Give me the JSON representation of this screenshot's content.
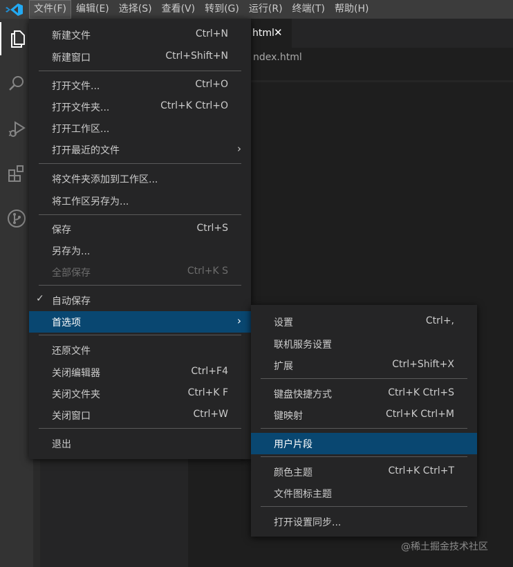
{
  "menubar": {
    "items": [
      {
        "label": "文件(F)"
      },
      {
        "label": "编辑(E)"
      },
      {
        "label": "选择(S)"
      },
      {
        "label": "查看(V)"
      },
      {
        "label": "转到(G)"
      },
      {
        "label": "运行(R)"
      },
      {
        "label": "终端(T)"
      },
      {
        "label": "帮助(H)"
      }
    ]
  },
  "editor": {
    "tab_label": "html",
    "tab_close": "✕",
    "breadcrumb": "ndex.html"
  },
  "file_menu": {
    "items": [
      {
        "label": "新建文件",
        "shortcut": "Ctrl+N"
      },
      {
        "label": "新建窗口",
        "shortcut": "Ctrl+Shift+N"
      },
      {
        "label": "打开文件...",
        "shortcut": "Ctrl+O"
      },
      {
        "label": "打开文件夹...",
        "shortcut": "Ctrl+K Ctrl+O"
      },
      {
        "label": "打开工作区..."
      },
      {
        "label": "打开最近的文件",
        "submenu_arrow": "›"
      },
      {
        "label": "将文件夹添加到工作区..."
      },
      {
        "label": "将工作区另存为..."
      },
      {
        "label": "保存",
        "shortcut": "Ctrl+S"
      },
      {
        "label": "另存为..."
      },
      {
        "label": "全部保存",
        "shortcut": "Ctrl+K S"
      },
      {
        "label": "自动保存",
        "check": "✓"
      },
      {
        "label": "首选项",
        "submenu_arrow": "›"
      },
      {
        "label": "还原文件"
      },
      {
        "label": "关闭编辑器",
        "shortcut": "Ctrl+F4"
      },
      {
        "label": "关闭文件夹",
        "shortcut": "Ctrl+K F"
      },
      {
        "label": "关闭窗口",
        "shortcut": "Ctrl+W"
      },
      {
        "label": "退出"
      }
    ]
  },
  "pref_menu": {
    "items": [
      {
        "label": "设置",
        "shortcut": "Ctrl+,"
      },
      {
        "label": "联机服务设置"
      },
      {
        "label": "扩展",
        "shortcut": "Ctrl+Shift+X"
      },
      {
        "label": "键盘快捷方式",
        "shortcut": "Ctrl+K Ctrl+S"
      },
      {
        "label": "键映射",
        "shortcut": "Ctrl+K Ctrl+M"
      },
      {
        "label": "用户片段"
      },
      {
        "label": "颜色主题",
        "shortcut": "Ctrl+K Ctrl+T"
      },
      {
        "label": "文件图标主题"
      },
      {
        "label": "打开设置同步..."
      }
    ]
  },
  "watermark": "@稀土掘金技术社区",
  "colors": {
    "menubar_bg": "#3c3c3c",
    "menu_bg": "#252526",
    "highlight": "#094771",
    "activity_bar": "#333333",
    "editor_bg": "#1e1e1e",
    "vscode_blue": "#23a9f2"
  },
  "icons": [
    "vscode-logo-icon",
    "files-icon",
    "search-icon",
    "run-debug-icon",
    "extensions-icon",
    "source-control-icon",
    "check-icon",
    "chevron-right-icon",
    "close-icon"
  ]
}
